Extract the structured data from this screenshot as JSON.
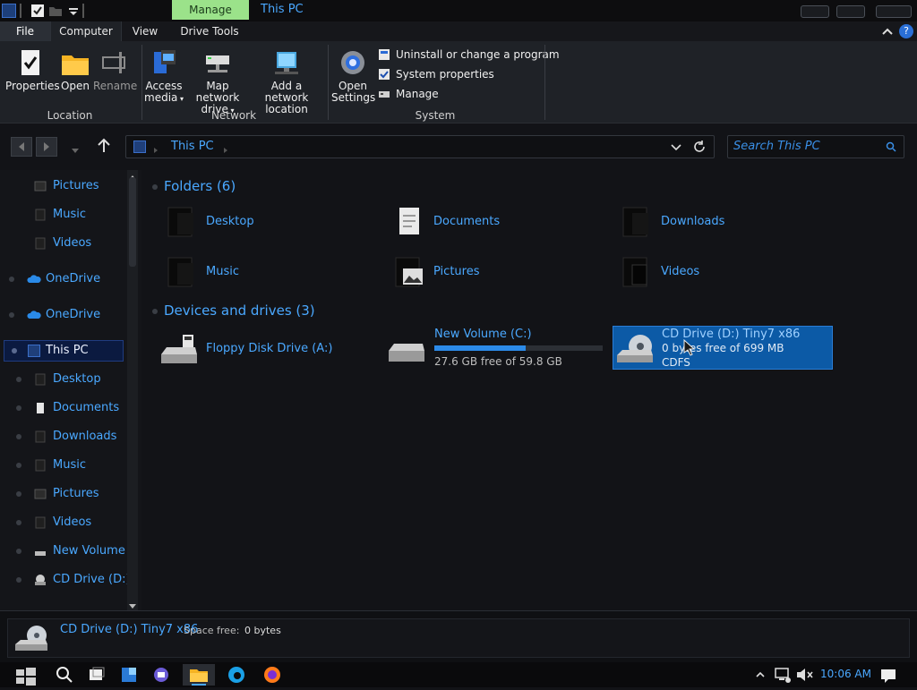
{
  "titlebar": {
    "context_tab": "Manage",
    "title": "This PC"
  },
  "tabs": [
    {
      "label": "File"
    },
    {
      "label": "Computer"
    },
    {
      "label": "View"
    },
    {
      "label": "Drive Tools"
    }
  ],
  "ribbon": {
    "location": {
      "label": "Location",
      "buttons": [
        {
          "label": "Properties"
        },
        {
          "label": "Open"
        },
        {
          "label": "Rename"
        }
      ]
    },
    "network": {
      "label": "Network",
      "access_media_1": "Access",
      "access_media_2": "media",
      "map_drive_1": "Map network",
      "map_drive_2": "drive",
      "add_location_1": "Add a network",
      "add_location_2": "location"
    },
    "system": {
      "label": "System",
      "open_settings_1": "Open",
      "open_settings_2": "Settings",
      "uninstall": "Uninstall or change a program",
      "properties": "System properties",
      "manage": "Manage"
    }
  },
  "address": {
    "path": "This PC",
    "search_placeholder": "Search This PC"
  },
  "sidebar": {
    "items": [
      {
        "label": "Pictures"
      },
      {
        "label": "Music"
      },
      {
        "label": "Videos"
      },
      {
        "label": "OneDrive"
      },
      {
        "label": "OneDrive"
      },
      {
        "label": "This PC"
      },
      {
        "label": "Desktop"
      },
      {
        "label": "Documents"
      },
      {
        "label": "Downloads"
      },
      {
        "label": "Music"
      },
      {
        "label": "Pictures"
      },
      {
        "label": "Videos"
      },
      {
        "label": "New Volume ("
      },
      {
        "label": "CD Drive (D:)"
      }
    ]
  },
  "content": {
    "folders_title": "Folders (6)",
    "folders": [
      {
        "label": "Desktop"
      },
      {
        "label": "Documents"
      },
      {
        "label": "Downloads"
      },
      {
        "label": "Music"
      },
      {
        "label": "Pictures"
      },
      {
        "label": "Videos"
      }
    ],
    "devices_title": "Devices and drives (3)",
    "drives": [
      {
        "label": "Floppy Disk Drive (A:)",
        "sub1": "",
        "sub2": ""
      },
      {
        "label": "New Volume (C:)",
        "sub1": "27.6 GB free of 59.8 GB",
        "sub2": "",
        "used_fraction": 0.54
      },
      {
        "label": "CD Drive (D:) Tiny7 x86",
        "sub1": "0 bytes free of 699 MB",
        "sub2": "CDFS"
      }
    ]
  },
  "details": {
    "name": "CD Drive (D:) Tiny7 x86",
    "space_label": "Space free:",
    "space_value": "0 bytes"
  },
  "taskbar": {
    "clock": "10:06 AM"
  }
}
